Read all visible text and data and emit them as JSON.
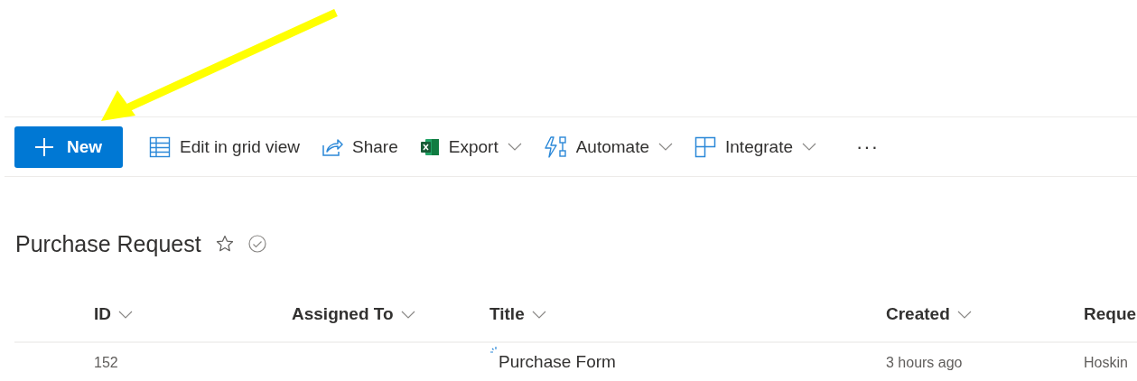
{
  "toolbar": [
    {
      "kind": "primary",
      "label": "New"
    },
    {
      "kind": "button",
      "label": "Edit in grid view"
    },
    {
      "kind": "button",
      "label": "Share"
    },
    {
      "kind": "dropdown",
      "label": "Export"
    },
    {
      "kind": "dropdown",
      "label": "Automate"
    },
    {
      "kind": "dropdown",
      "label": "Integrate"
    },
    {
      "kind": "more",
      "label": "···"
    }
  ],
  "list": {
    "title": "Purchase Request"
  },
  "table": {
    "columns": [
      {
        "label": "ID",
        "sortable": true
      },
      {
        "label": "Assigned To",
        "sortable": true
      },
      {
        "label": "Title",
        "sortable": true
      },
      {
        "label": "Created",
        "sortable": true
      },
      {
        "label": "Reque"
      }
    ],
    "rows": [
      {
        "cells": [
          "152",
          "",
          "Purchase Form",
          "3 hours ago",
          "Hoskin"
        ],
        "loading": true
      }
    ]
  }
}
